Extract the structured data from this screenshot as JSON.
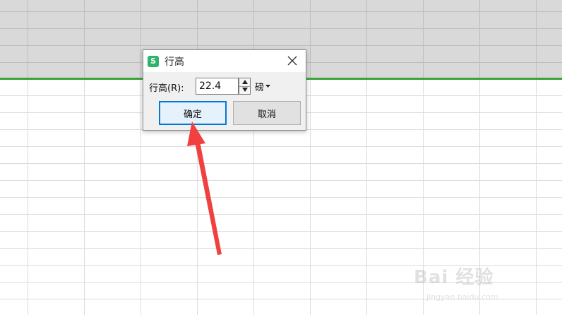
{
  "dialog": {
    "title": "行高",
    "app_icon": "S",
    "row_height_label": "行高(R):",
    "row_height_value": "22.4",
    "unit": "磅",
    "ok_label": "确定",
    "cancel_label": "取消"
  },
  "watermark": {
    "brand": "Bai 经验",
    "url": "jingyan.baidu.com"
  },
  "colors": {
    "accent_green": "#3aa33a",
    "app_icon_green": "#2fb36a",
    "focus_blue": "#0078d7",
    "annotation_red": "#f04040"
  }
}
